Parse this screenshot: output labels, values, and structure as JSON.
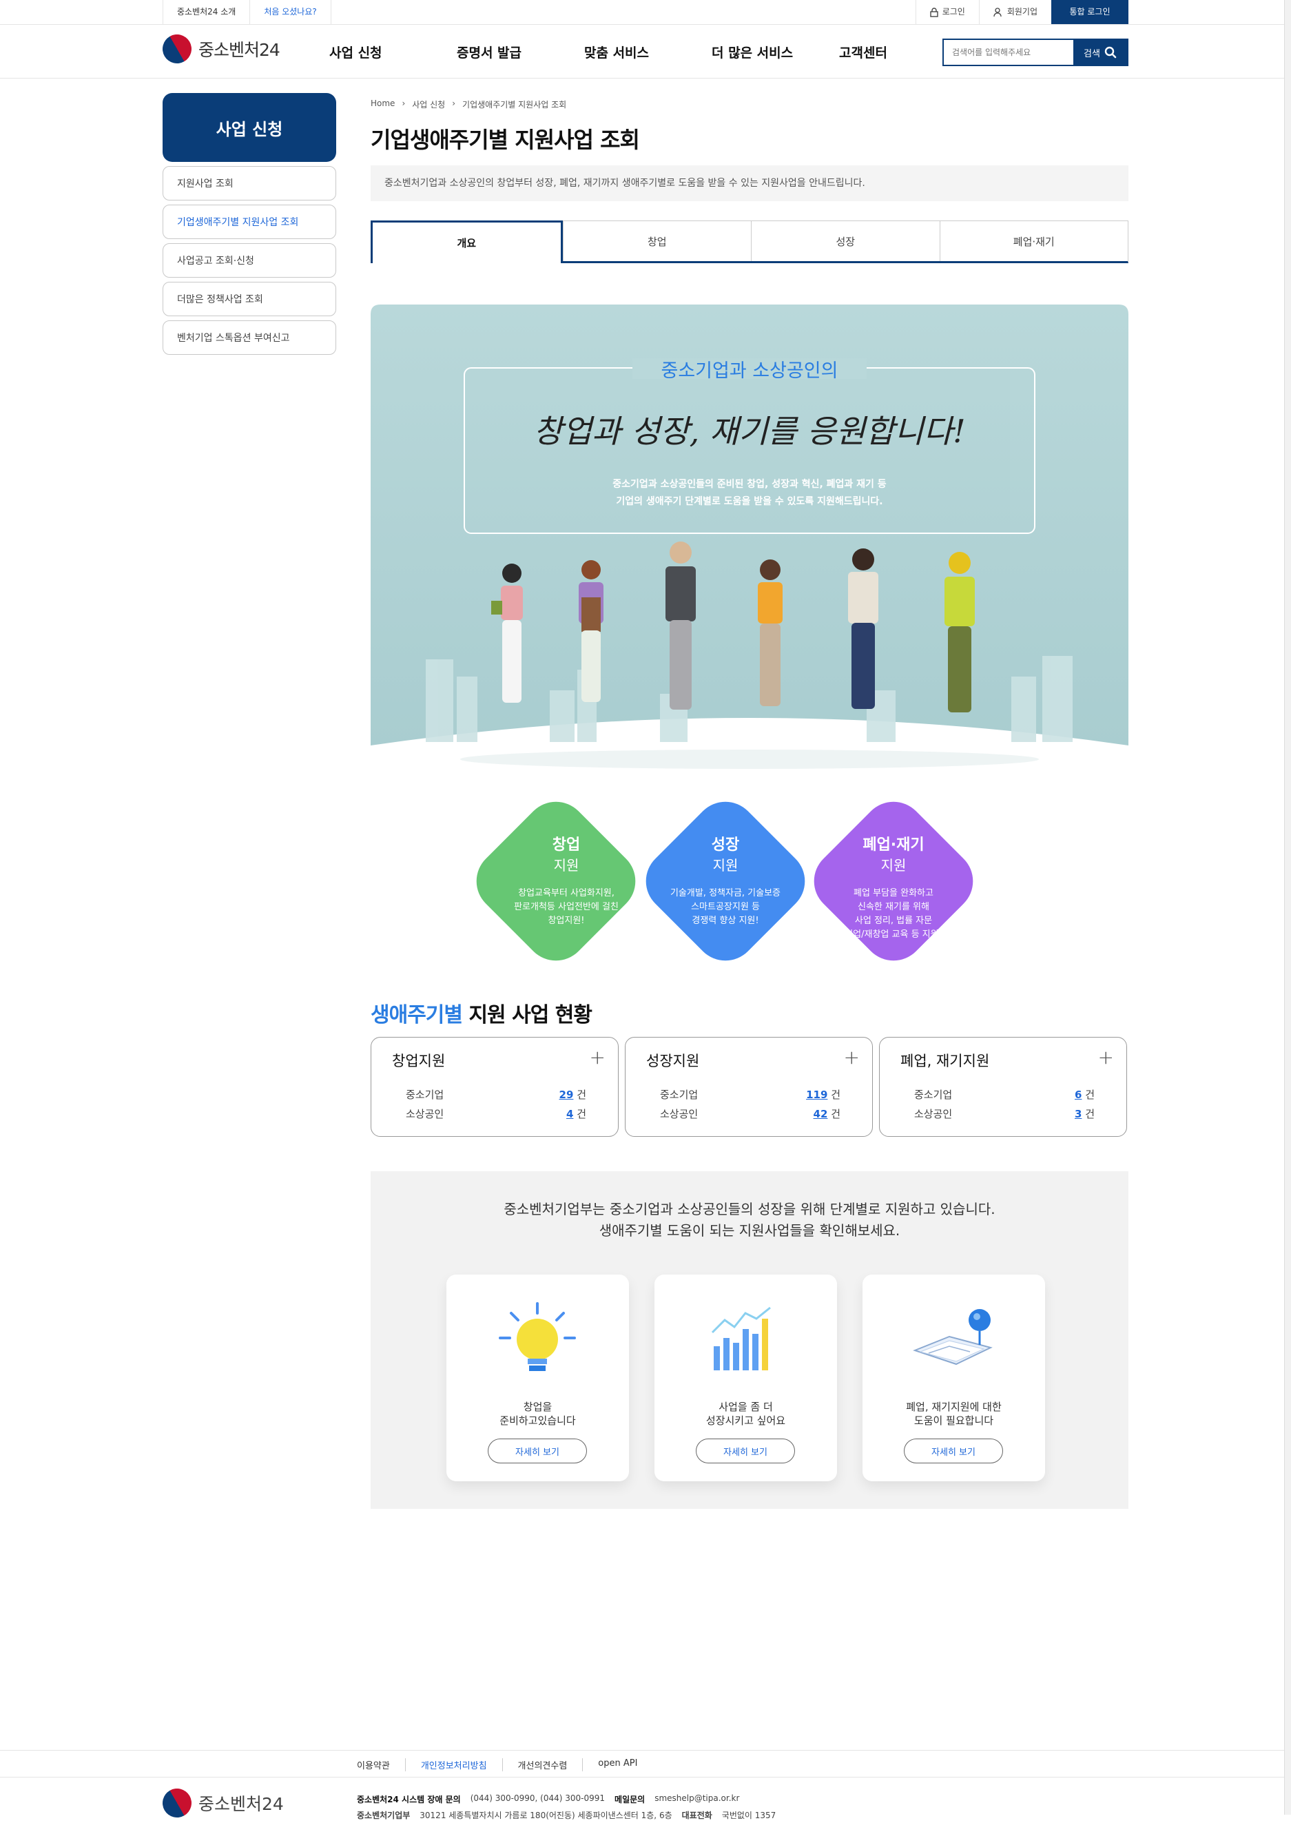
{
  "util": {
    "about": "중소벤처24 소개",
    "first_visit": "처음 오셨나요?",
    "login": "로그인",
    "member_company": "회원기업",
    "unified_login": "통합 로그인"
  },
  "logo": {
    "name": "중소벤처24"
  },
  "menu": [
    "사업 신청",
    "증명서 발급",
    "맞춤 서비스",
    "더 많은 서비스",
    "고객센터"
  ],
  "search": {
    "placeholder": "검색어를 입력해주세요",
    "button": "검색"
  },
  "sidebar": {
    "title": "사업 신청",
    "items": [
      {
        "label": "지원사업 조회"
      },
      {
        "label": "기업생애주기별 지원사업 조회"
      },
      {
        "label": "사업공고 조회·신청"
      },
      {
        "label": "더많은 정책사업 조회"
      },
      {
        "label": "벤처기업 스톡옵션 부여신고"
      }
    ]
  },
  "breadcrumb": [
    "Home",
    "사업 신청",
    "기업생애주기별 지원사업 조회"
  ],
  "page": {
    "title": "기업생애주기별 지원사업 조회",
    "description": "중소벤처기업과 소상공인의 창업부터 성장, 폐업, 재기까지 생애주기별로 도움을 받을 수 있는 지원사업을 안내드립니다."
  },
  "tabs": [
    "개요",
    "창업",
    "성장",
    "폐업·재기"
  ],
  "hero": {
    "heading": "중소기업과 소상공인의",
    "slogan": "창업과 성장, 재기를 응원합니다!",
    "sub1": "중소기업과 소상공인들의 준비된 창업, 성장과 혁신, 폐업과 재기 등",
    "sub2": "기업의 생애주기 단계별로 도움을 받을 수 있도록 지원해드립니다."
  },
  "diamonds": [
    {
      "t1": "창업",
      "t2": "지원",
      "lines": [
        "창업교육부터 사업화지원,",
        "판로개척등 사업전반에 걸친",
        "창업지원!"
      ],
      "color": "#5ec46c"
    },
    {
      "t1": "성장",
      "t2": "지원",
      "lines": [
        "기술개발, 정책자금, 기술보증",
        "스마트공장지원 등",
        "경쟁력 향상 지원!"
      ],
      "color": "#3a86f0"
    },
    {
      "t1": "폐업·재기",
      "t2": "지원",
      "lines": [
        "폐업 부담을 완화하고",
        "신속한 재기를 위해",
        "사업 정리, 법률 자문",
        "취업/재창업 교육 등 지원!"
      ],
      "color": "#a05cec"
    }
  ],
  "status": {
    "title_hl": "생애주기별",
    "title_rest": " 지원 사업 현황",
    "cards": [
      {
        "title": "창업지원",
        "rows": [
          {
            "label": "중소기업",
            "count": "29",
            "unit": "건"
          },
          {
            "label": "소상공인",
            "count": "4",
            "unit": "건"
          }
        ]
      },
      {
        "title": "성장지원",
        "rows": [
          {
            "label": "중소기업",
            "count": "119",
            "unit": "건"
          },
          {
            "label": "소상공인",
            "count": "42",
            "unit": "건"
          }
        ]
      },
      {
        "title": "폐업, 재기지원",
        "rows": [
          {
            "label": "중소기업",
            "count": "6",
            "unit": "건"
          },
          {
            "label": "소상공인",
            "count": "3",
            "unit": "건"
          }
        ]
      }
    ]
  },
  "guide": {
    "line1": "중소벤처기업부는 중소기업과 소상공인들의 성장을 위해 단계별로 지원하고 있습니다.",
    "line2": "생애주기별 도움이 되는 지원사업들을 확인해보세요.",
    "cards": [
      {
        "line1": "창업을",
        "line2": "준비하고있습니다",
        "button": "자세히 보기",
        "icon": "lightbulb-icon"
      },
      {
        "line1": "사업을 좀 더",
        "line2": "성장시키고 싶어요",
        "button": "자세히 보기",
        "icon": "bar-chart-icon"
      },
      {
        "line1": "폐업, 재기지원에 대한",
        "line2": "도움이 필요합니다",
        "button": "자세히 보기",
        "icon": "map-pin-icon"
      }
    ]
  },
  "footer": {
    "links": [
      "이용약관",
      "개인정보처리방침",
      "개선의견수렴",
      "open API"
    ],
    "logo": "중소벤처24",
    "inquiry_label": "중소벤처24 시스템 장애 문의",
    "phone": "(044) 300-0990, (044) 300-0991",
    "mail_label": "메일문의",
    "mail": "smeshelp@tipa.or.kr",
    "addr_label": "중소벤처기업부",
    "addr": "30121 세종특별자치시 가름로 180(어진동) 세종파이낸스센터 1층, 6층",
    "tel_label": "대표전화",
    "tel": "국번없이 1357"
  }
}
